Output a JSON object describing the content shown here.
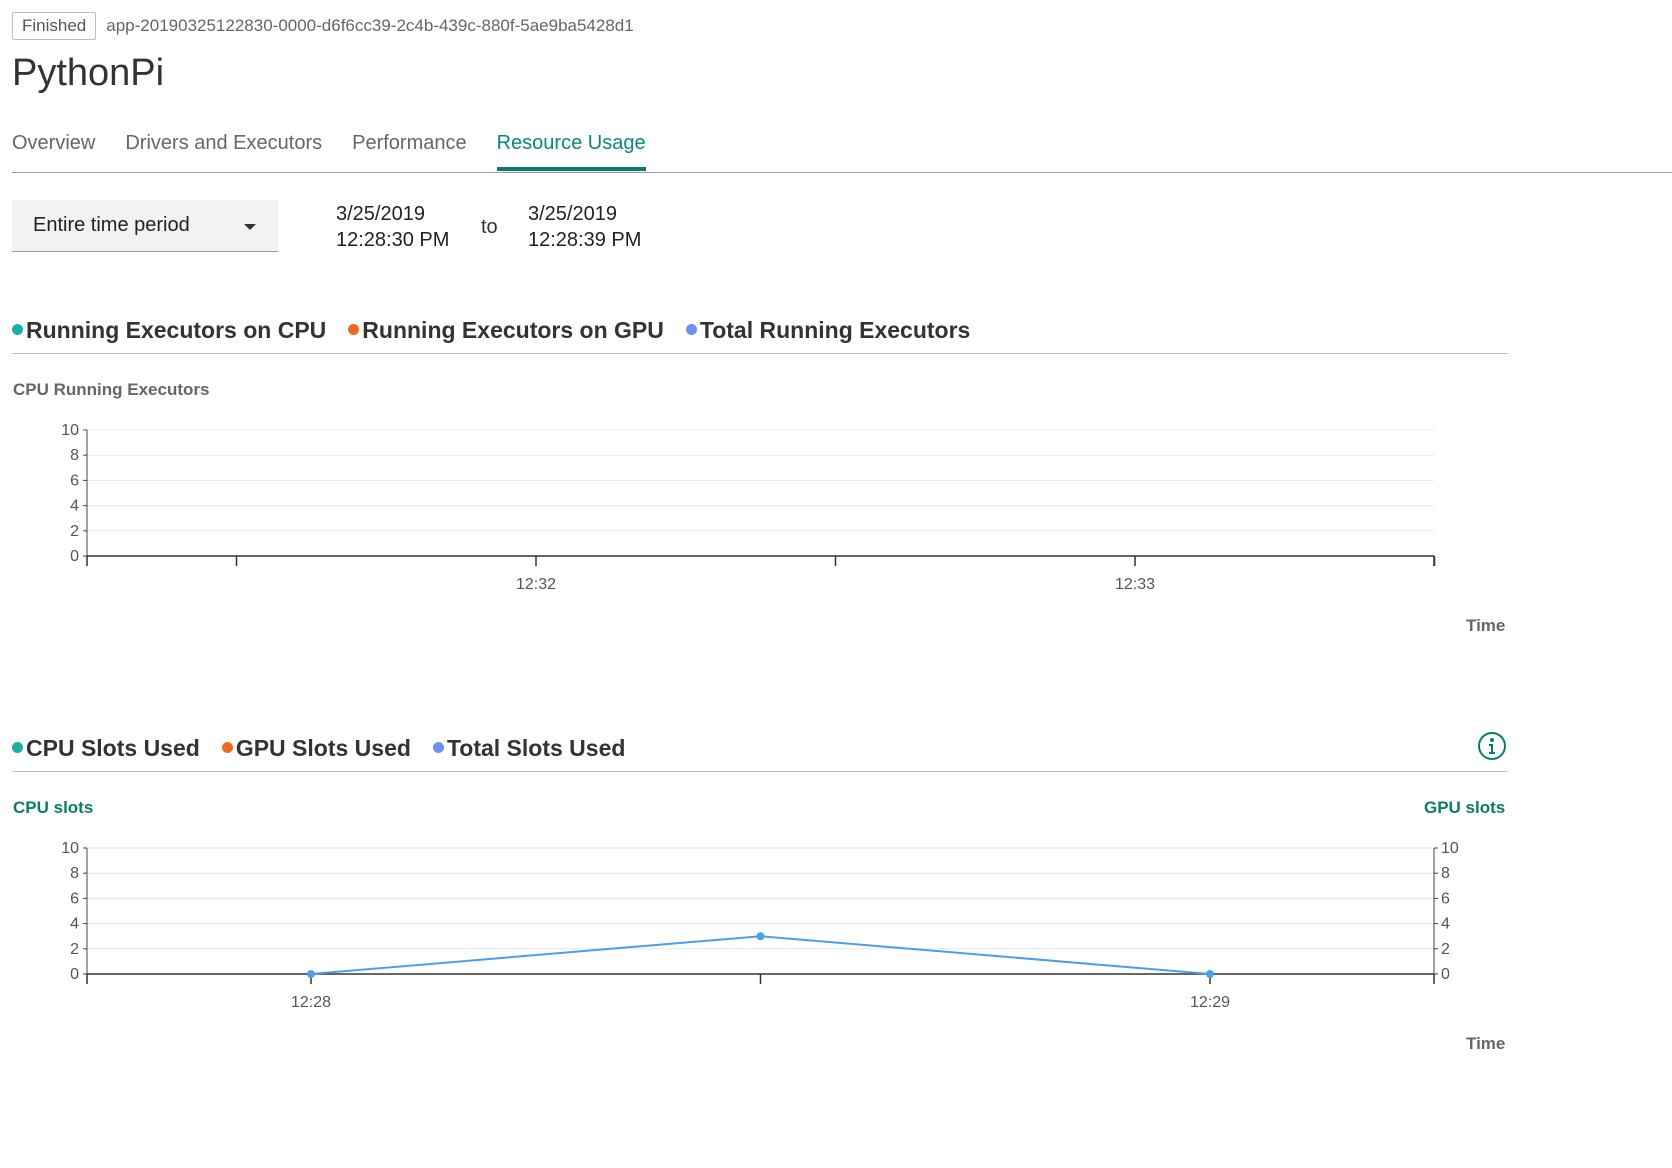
{
  "header": {
    "status": "Finished",
    "app_id": "app-20190325122830-0000-d6f6cc39-2c4b-439c-880f-5ae9ba5428d1",
    "title": "PythonPi"
  },
  "tabs": [
    {
      "label": "Overview",
      "active": false
    },
    {
      "label": "Drivers and Executors",
      "active": false
    },
    {
      "label": "Performance",
      "active": false
    },
    {
      "label": "Resource Usage",
      "active": true
    }
  ],
  "filter": {
    "period": "Entire time period",
    "from_date": "3/25/2019",
    "from_time": "12:28:30 PM",
    "to_label": "to",
    "to_date": "3/25/2019",
    "to_time": "12:28:39 PM"
  },
  "colors": {
    "accent": "#0a7c68",
    "cpu": "#17b3a0",
    "gpu": "#ee6a1e",
    "total": "#6a92ef",
    "line": "#4a9fe8"
  },
  "executors_section": {
    "legend": [
      "Running Executors on CPU",
      "Running Executors on GPU",
      "Total Running Executors"
    ],
    "y_axis_title": "CPU Running Executors",
    "x_axis_title": "Time"
  },
  "slots_section": {
    "legend": [
      "CPU Slots Used",
      "GPU Slots Used",
      "Total Slots Used"
    ],
    "y_axis_title_left": "CPU slots",
    "y_axis_title_right": "GPU slots",
    "x_axis_title": "Time",
    "info_icon": "info-icon"
  },
  "chart_data": [
    {
      "type": "line",
      "title": "",
      "ylabel": "CPU Running Executors",
      "xlabel": "Time",
      "ylim": [
        0,
        10
      ],
      "yticks": [
        "0",
        "2",
        "4",
        "6",
        "8",
        "10"
      ],
      "xticks": [
        "12:32",
        "12:33"
      ],
      "grid": true,
      "series": []
    },
    {
      "type": "line",
      "title": "",
      "ylabel": "CPU slots",
      "ylabel_right": "GPU slots",
      "xlabel": "Time",
      "ylim": [
        0,
        10
      ],
      "yticks": [
        "0",
        "2",
        "4",
        "6",
        "8",
        "10"
      ],
      "xticks": [
        "12:28",
        "12:29"
      ],
      "grid": true,
      "series": [
        {
          "x": [
            "12:28",
            "12:28:30",
            "12:29"
          ],
          "values": [
            0,
            3,
            0
          ]
        }
      ]
    }
  ]
}
